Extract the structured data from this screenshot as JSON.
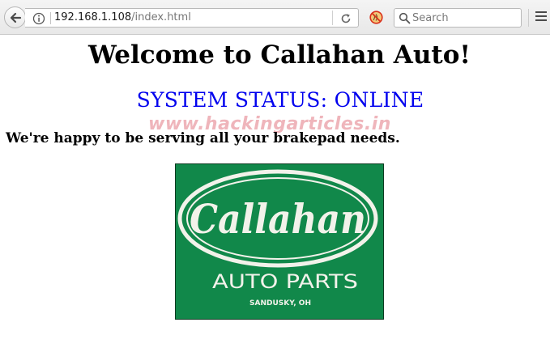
{
  "browser": {
    "url_host": "192.168.1.108",
    "url_path": "/index.html",
    "search_placeholder": "Search",
    "icons": {
      "back": "back-arrow-icon",
      "site_info": "info-icon",
      "reload": "reload-icon",
      "extension": "noscript-icon",
      "search": "search-icon",
      "menu": "hamburger-menu-icon"
    }
  },
  "page": {
    "title": "Welcome to Callahan Auto!",
    "status": "SYSTEM STATUS: ONLINE",
    "status_color": "#0000ee",
    "tagline": "We're happy to be serving all your brakepad needs.",
    "watermark": "www.hackingarticles.in"
  },
  "logo": {
    "brand": "Callahan",
    "line2": "AUTO PARTS",
    "location": "SANDUSKY, OH",
    "background_color": "#11884a"
  }
}
